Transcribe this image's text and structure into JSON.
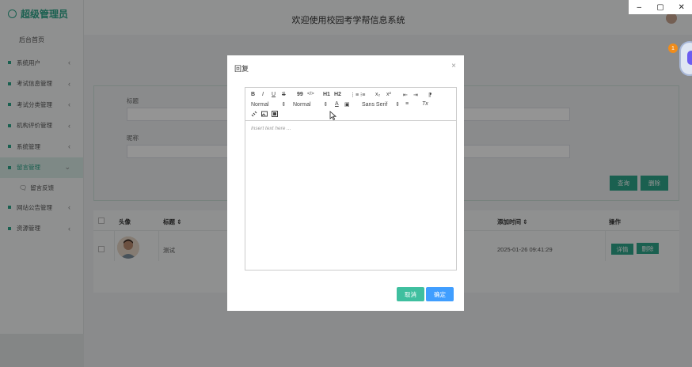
{
  "window_controls": {
    "minimize": "–",
    "restore": "▢",
    "close": "✕"
  },
  "sidebar": {
    "brand": "超级管理员",
    "home": "后台首页",
    "items": [
      {
        "label": "系统用户",
        "chevron": "‹"
      },
      {
        "label": "考试信息管理",
        "chevron": "‹"
      },
      {
        "label": "考试分类管理",
        "chevron": "‹"
      },
      {
        "label": "机构评价管理",
        "chevron": "‹"
      },
      {
        "label": "系统管理",
        "chevron": "‹"
      },
      {
        "label": "留言管理",
        "chevron": "⌄"
      },
      {
        "label": "留言反馈"
      },
      {
        "label": "网站公告管理",
        "chevron": "‹"
      },
      {
        "label": "资源管理",
        "chevron": "‹"
      }
    ]
  },
  "header": {
    "title": "欢迎使用校园考学帮信息系统"
  },
  "search": {
    "label1": "标题",
    "label2": "昵称",
    "query_button": "查询",
    "delete_button": "删除"
  },
  "table": {
    "headers": {
      "avatar": "头像",
      "title": "标题 ⇕",
      "reply_time": "添加时间 ⇕",
      "action": "操作"
    },
    "row": {
      "title": "测试",
      "time": "2025-01-26 09:41:29",
      "detail": "详情",
      "delete": "删除"
    }
  },
  "float_widget": {
    "badge": "1"
  },
  "modal": {
    "title": "回复",
    "close": "×",
    "toolbar": {
      "bold": "B",
      "italic": "I",
      "underline": "U",
      "strike": "S",
      "quote": "99",
      "code": "</>",
      "h1": "H1",
      "h2": "H2",
      "ol": "⋮≡",
      "ul": "⁝≡",
      "sub": "x₂",
      "sup": "x²",
      "outdent": "⇤",
      "indent": "⇥",
      "direction": "⁋",
      "size": "Normal",
      "header": "Normal",
      "color": "A",
      "background": "▣",
      "font": "Sans Serif",
      "align": "≡",
      "clean": "Tx",
      "link": "🔗",
      "image": "▨",
      "video": "▤"
    },
    "placeholder": "Insert text here ...",
    "cancel": "取消",
    "ok": "确定"
  },
  "colors": {
    "accent": "#2ea58a",
    "primary": "#409eff",
    "cancel": "#3fbf9f"
  }
}
